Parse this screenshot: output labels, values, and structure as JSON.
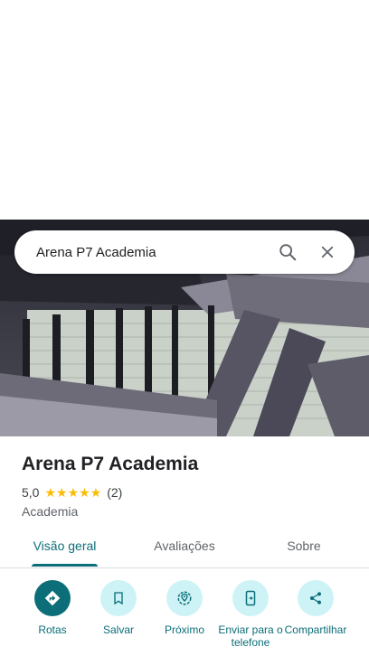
{
  "search": {
    "query": "Arena P7 Academia"
  },
  "place": {
    "name": "Arena P7 Academia",
    "rating": "5,0",
    "stars": "★★★★★",
    "review_count": "(2)",
    "category": "Academia"
  },
  "tabs": [
    {
      "label": "Visão geral"
    },
    {
      "label": "Avaliações"
    },
    {
      "label": "Sobre"
    }
  ],
  "actions": [
    {
      "label": "Rotas",
      "icon": "directions-icon"
    },
    {
      "label": "Salvar",
      "icon": "bookmark-icon"
    },
    {
      "label": "Próximo",
      "icon": "nearby-icon"
    },
    {
      "label": "Enviar para o telefone",
      "icon": "send-to-phone-icon"
    },
    {
      "label": "Compartilhar",
      "icon": "share-icon"
    }
  ],
  "colors": {
    "accent": "#0b6e78",
    "action_bg": "#cef3f7",
    "star": "#fbbc04"
  }
}
